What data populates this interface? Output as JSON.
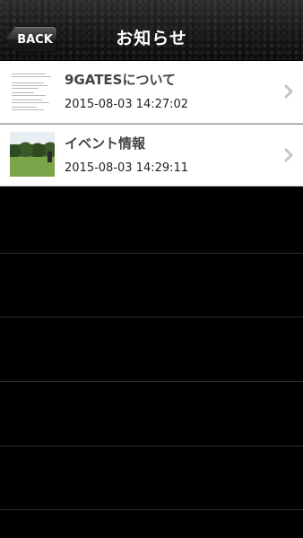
{
  "navbar": {
    "back_label": "BACK",
    "title": "お知らせ"
  },
  "items": [
    {
      "title": "9GATESについて",
      "date": "2015-08-03 14:27:02",
      "thumbnail_icon": "document-thumbnail"
    },
    {
      "title": "イベント情報",
      "date": "2015-08-03 14:29:11",
      "thumbnail_icon": "golf-course-thumbnail"
    }
  ]
}
